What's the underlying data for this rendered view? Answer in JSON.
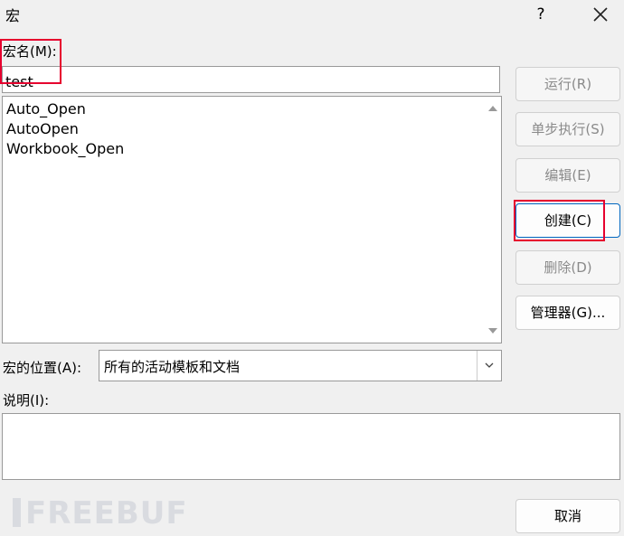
{
  "dialog": {
    "title": "宏",
    "help": "?"
  },
  "macro_name": {
    "label": "宏名(M):",
    "value": "test"
  },
  "macro_list": {
    "items": [
      "Auto_Open",
      "AutoOpen",
      "Workbook_Open"
    ]
  },
  "location": {
    "label": "宏的位置(A):",
    "value": "所有的活动模板和文档"
  },
  "description": {
    "label": "说明(I):"
  },
  "buttons": {
    "run": "运行(R)",
    "step": "单步执行(S)",
    "edit": "编辑(E)",
    "create": "创建(C)",
    "delete": "删除(D)",
    "organizer": "管理器(G)...",
    "cancel": "取消"
  },
  "watermark": "FREEBUF",
  "colors": {
    "highlight": "#e6002e",
    "focus_border": "#0067c0"
  }
}
